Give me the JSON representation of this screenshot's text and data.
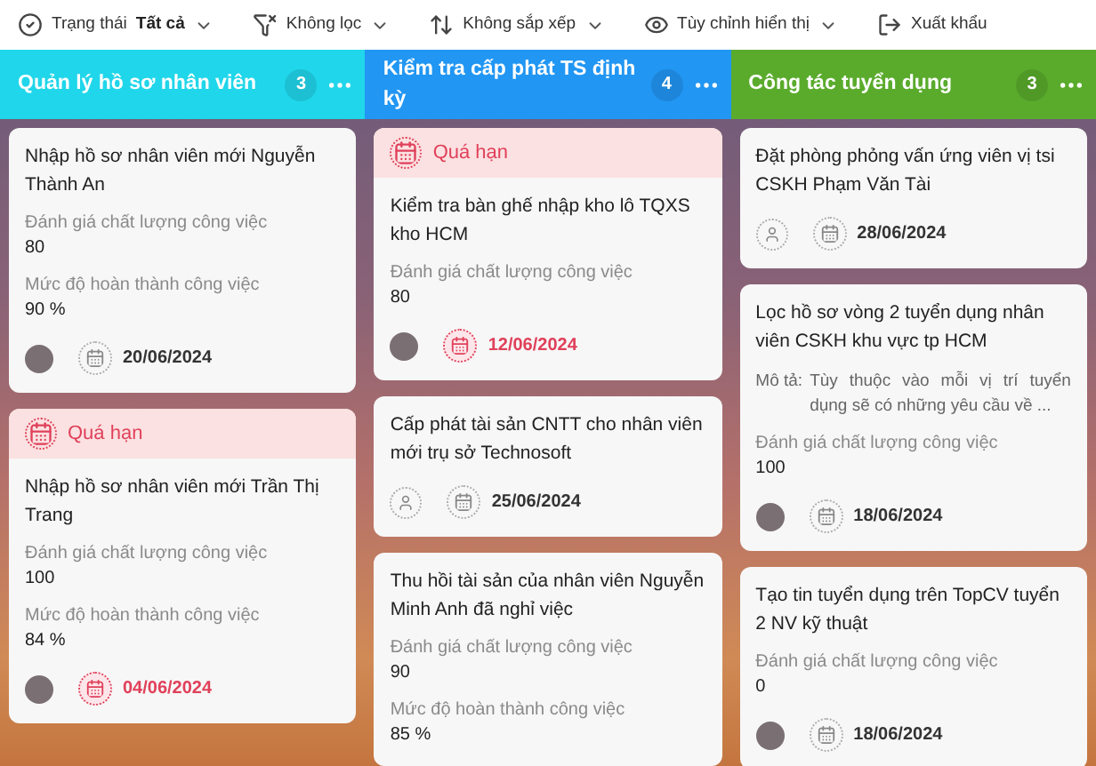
{
  "toolbar": [
    {
      "kind": "dropdown",
      "label": "Trạng thái",
      "value": "Tất cả"
    },
    {
      "kind": "dropdown",
      "label": "Không lọc"
    },
    {
      "kind": "dropdown",
      "label": "Không sắp xếp"
    },
    {
      "kind": "dropdown",
      "label": "Tùy chỉnh hiển thị"
    },
    {
      "kind": "button",
      "label": "Xuất khẩu"
    }
  ],
  "columns": [
    {
      "title": "Quản lý hồ sơ nhân viên",
      "count": "3",
      "color": "#20d6ea",
      "cards": [
        {
          "overdue": false,
          "title": "Nhập hồ sơ nhân viên mới Nguyễn Thành An",
          "fields": [
            {
              "label": "Đánh giá chất lượng công việc",
              "value": "80"
            },
            {
              "label": "Mức độ hoàn thành công việc",
              "value": "90 %"
            }
          ],
          "assigned": true,
          "date": "20/06/2024"
        },
        {
          "overdue": true,
          "badge": "Quá hạn",
          "title": "Nhập hồ sơ nhân viên mới Trần Thị Trang",
          "fields": [
            {
              "label": "Đánh giá chất lượng công việc",
              "value": "100"
            },
            {
              "label": "Mức độ hoàn thành công việc",
              "value": "84 %"
            }
          ],
          "assigned": true,
          "date": "04/06/2024"
        }
      ]
    },
    {
      "title": "Kiểm tra cấp phát TS định kỳ",
      "count": "4",
      "color": "#2196f3",
      "cards": [
        {
          "overdue": true,
          "badge": "Quá hạn",
          "title": "Kiểm tra bàn ghế nhập kho lô TQXS kho HCM",
          "fields": [
            {
              "label": "Đánh giá chất lượng công việc",
              "value": "80"
            }
          ],
          "assigned": true,
          "date": "12/06/2024"
        },
        {
          "overdue": false,
          "title": "Cấp phát tài sản CNTT cho nhân viên mới trụ sở Technosoft",
          "assigned": false,
          "date": "25/06/2024"
        },
        {
          "overdue": false,
          "title": "Thu hồi tài sản của nhân viên Nguyễn Minh Anh đã nghỉ việc",
          "fields": [
            {
              "label": "Đánh giá chất lượng công việc",
              "value": "90"
            },
            {
              "label": "Mức độ hoàn thành công việc",
              "value": "85 %"
            }
          ]
        }
      ]
    },
    {
      "title": "Công tác tuyển dụng",
      "count": "3",
      "color": "#5aab2c",
      "cards": [
        {
          "overdue": false,
          "title": "Đặt phòng phỏng vấn ứng viên vị tsi CSKH Phạm Văn Tài",
          "assigned": false,
          "date": "28/06/2024"
        },
        {
          "overdue": false,
          "title": "Lọc hồ sơ vòng 2 tuyển dụng nhân viên CSKH khu vực tp HCM",
          "description": {
            "label": "Mô tả:",
            "text": "Tùy thuộc vào mỗi vị trí tuyển dụng sẽ có những yêu cầu về ..."
          },
          "fields": [
            {
              "label": "Đánh giá chất lượng công việc",
              "value": "100"
            }
          ],
          "assigned": true,
          "date": "18/06/2024"
        },
        {
          "overdue": false,
          "title": "Tạo tin tuyển dụng trên TopCV tuyển 2 NV kỹ thuật",
          "fields": [
            {
              "label": "Đánh giá chất lượng công việc",
              "value": "0"
            }
          ],
          "assigned": true,
          "date": "18/06/2024"
        }
      ]
    }
  ]
}
